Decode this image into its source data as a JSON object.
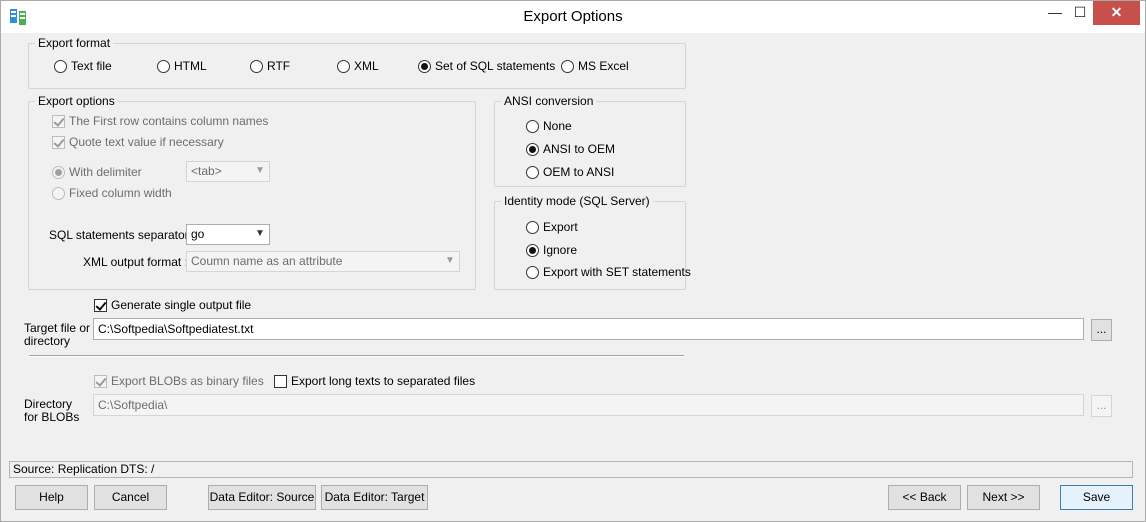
{
  "window": {
    "title": "Export Options",
    "minimize_glyph": "—",
    "maximize_glyph": "☐",
    "close_glyph": "✕",
    "close_color": "#c7504b"
  },
  "export_format": {
    "group_label": "Export format",
    "options": [
      {
        "label": "Text file",
        "selected": false
      },
      {
        "label": "HTML",
        "selected": false
      },
      {
        "label": "RTF",
        "selected": false
      },
      {
        "label": "XML",
        "selected": false
      },
      {
        "label": "Set of SQL statements",
        "selected": true
      },
      {
        "label": "MS Excel",
        "selected": false
      }
    ]
  },
  "export_options": {
    "group_label": "Export options",
    "first_row_column_names": {
      "label": "The First row contains column names",
      "checked": true,
      "enabled": false
    },
    "quote_text": {
      "label": "Quote text value if necessary",
      "checked": true,
      "enabled": false
    },
    "with_delimiter": {
      "label": "With delimiter",
      "selected": true,
      "enabled": false
    },
    "delimiter_value": "<tab>",
    "fixed_column_width": {
      "label": "Fixed column width",
      "selected": false,
      "enabled": false
    },
    "sql_separator_label": "SQL statements separator :",
    "sql_separator_value": "go",
    "xml_output_label": "XML output format :",
    "xml_output_value": "Coumn name as an attribute"
  },
  "ansi_conversion": {
    "group_label": "ANSI conversion",
    "options": [
      {
        "label": "None",
        "selected": false
      },
      {
        "label": "ANSI to OEM",
        "selected": true
      },
      {
        "label": "OEM to ANSI",
        "selected": false
      }
    ]
  },
  "identity_mode": {
    "group_label": "Identity mode (SQL Server)",
    "options": [
      {
        "label": "Export",
        "selected": false
      },
      {
        "label": "Ignore",
        "selected": true
      },
      {
        "label": "Export with SET statements",
        "selected": false
      }
    ]
  },
  "output": {
    "single_file": {
      "label": "Generate single output file",
      "checked": true
    },
    "target_label_line1": "Target file or",
    "target_label_line2": "directory",
    "target_value": "C:\\Softpedia\\Softpediatest.txt",
    "browse_label": "...",
    "blobs_binary": {
      "label": "Export BLOBs as binary files",
      "checked": true,
      "enabled": false
    },
    "long_texts": {
      "label": "Export long texts to separated files",
      "checked": false
    },
    "blob_dir_label_line1": "Directory",
    "blob_dir_label_line2": "for BLOBs",
    "blob_dir_value": "C:\\Softpedia\\",
    "blob_browse_label": "..."
  },
  "status": {
    "text": "Source: Replication DTS: /"
  },
  "buttons": {
    "help": "Help",
    "cancel": "Cancel",
    "data_editor_source": "Data Editor: Source",
    "data_editor_target": "Data Editor: Target",
    "back": "<< Back",
    "next": "Next >>",
    "save": "Save"
  }
}
